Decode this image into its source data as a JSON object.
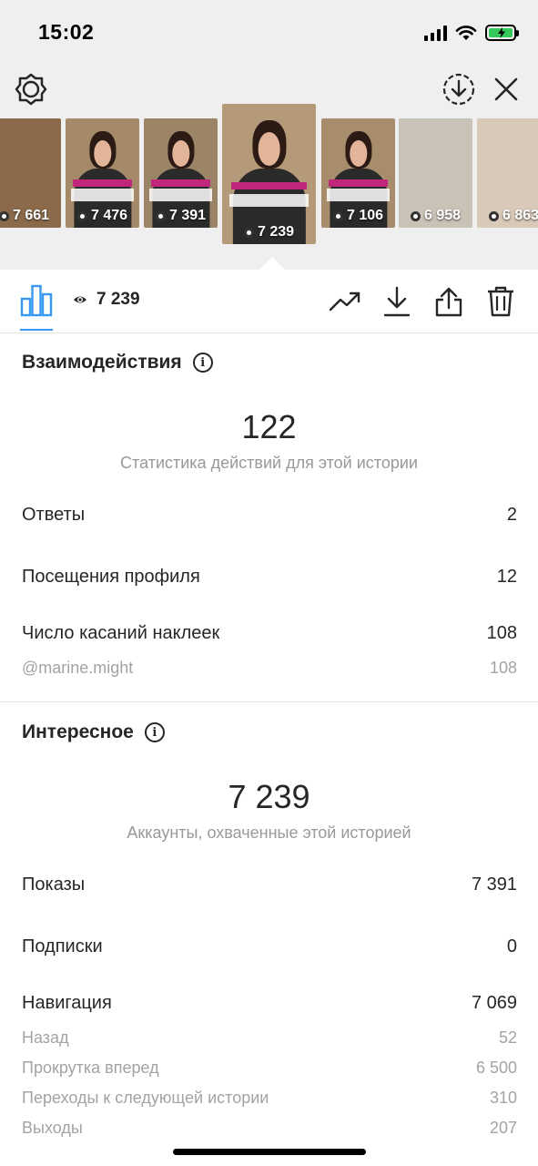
{
  "status_bar": {
    "time": "15:02"
  },
  "toolbar": {
    "settings_icon": "gear-icon",
    "download_icon": "download-circle-icon",
    "close_icon": "close-icon"
  },
  "stories": [
    {
      "views": "7 661",
      "bg": "#8a6a4a"
    },
    {
      "views": "7 476",
      "bg": "#a58a6a"
    },
    {
      "views": "7 391",
      "bg": "#9c8467"
    },
    {
      "views": "7 239",
      "bg": "#b59a7a",
      "selected": true
    },
    {
      "views": "7 106",
      "bg": "#a88d6c"
    },
    {
      "views": "6 958",
      "bg": "#c9c2b7"
    },
    {
      "views": "6 863",
      "bg": "#d8c9b8"
    }
  ],
  "action_bar": {
    "views_count": "7 239",
    "icons": [
      "bar-chart-icon",
      "trending-icon",
      "download-icon",
      "share-icon",
      "trash-icon"
    ]
  },
  "interactions": {
    "title": "Взаимодействия",
    "total": "122",
    "caption": "Статистика действий для этой истории",
    "rows": [
      {
        "label": "Ответы",
        "value": "2"
      },
      {
        "label": "Посещения профиля",
        "value": "12"
      },
      {
        "label": "Число касаний наклеек",
        "value": "108"
      }
    ],
    "sub_rows": [
      {
        "label": "@marine.might",
        "value": "108"
      }
    ]
  },
  "discovery": {
    "title": "Интересное",
    "total": "7 239",
    "caption": "Аккаунты, охваченные этой историей",
    "rows": [
      {
        "label": "Показы",
        "value": "7 391"
      },
      {
        "label": "Подписки",
        "value": "0"
      },
      {
        "label": "Навигация",
        "value": "7 069"
      }
    ],
    "sub_rows": [
      {
        "label": "Назад",
        "value": "52"
      },
      {
        "label": "Прокрутка вперед",
        "value": "6 500"
      },
      {
        "label": "Переходы к следующей истории",
        "value": "310"
      },
      {
        "label": "Выходы",
        "value": "207"
      }
    ]
  },
  "colors": {
    "accent": "#3897f0",
    "battery": "#34c759",
    "tag": "#c0267a"
  }
}
